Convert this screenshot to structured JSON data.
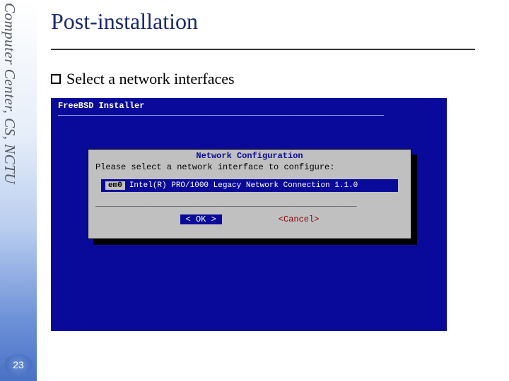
{
  "sidebar": {
    "label": "Computer Center, CS, NCTU",
    "page_number": "23"
  },
  "slide": {
    "title": "Post-installation",
    "bullet": "Select a network interfaces"
  },
  "installer": {
    "header": "FreeBSD Installer",
    "dashes": "────────────────────────────────────────────────────────────────",
    "dialog": {
      "title": "Network Configuration",
      "prompt": "Please select a network interface to configure:",
      "interface": {
        "name": "em0",
        "description": "Intel(R) PRO/1000 Legacy Network Connection 1.1.0"
      },
      "separator": "────────────────────────────────────────────────────────",
      "ok_label": "<  OK  >",
      "cancel_label": "<Cancel>"
    }
  }
}
